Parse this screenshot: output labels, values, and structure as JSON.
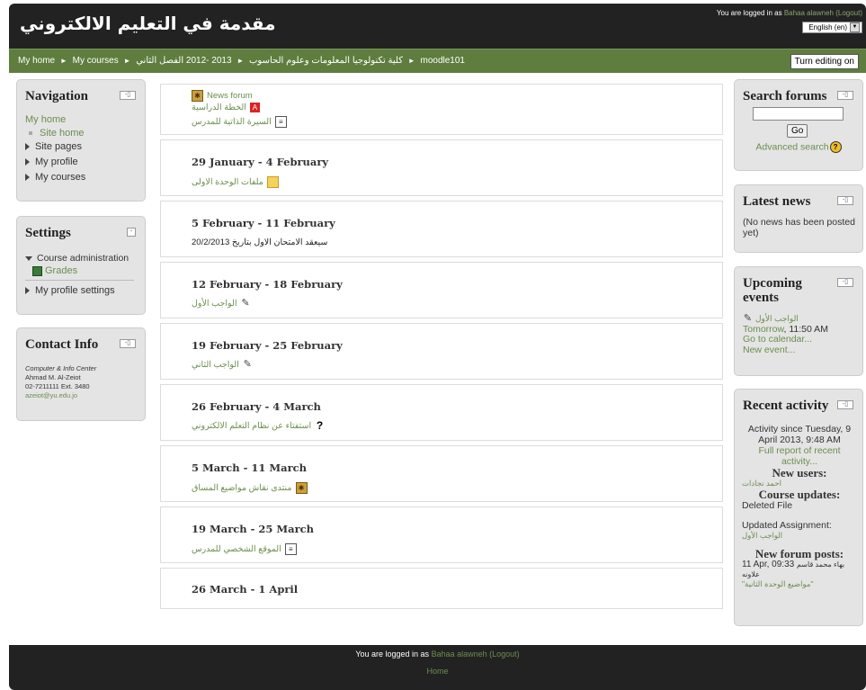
{
  "header": {
    "site_title": "مقدمة في التعليم الالكتروني",
    "logged_prefix": "You are logged in as",
    "user_name": "Bahaa alawneh",
    "logout_label": "(Logout)",
    "language": "English (en)"
  },
  "breadcrumb": {
    "items": [
      "My home",
      "My courses",
      "كلية تكنولوجيا المعلومات وعلوم الحاسوب",
      "2013 -2012 الفصل الثاني",
      "moodle101"
    ],
    "separator": "►"
  },
  "turn_editing_label": "Turn editing on",
  "navigation": {
    "title": "Navigation",
    "items": [
      {
        "label": "My home"
      },
      {
        "label": "Site home"
      },
      {
        "label": "Site pages"
      },
      {
        "label": "My profile"
      },
      {
        "label": "My courses"
      }
    ]
  },
  "settings": {
    "title": "Settings",
    "course_admin": "Course administration",
    "grades": "Grades",
    "profile_settings": "My profile settings"
  },
  "contact": {
    "title": "Contact Info",
    "org": "Computer & Info Center",
    "name": "Ahmad M. Al-Zeiot",
    "phone": "02-7211111 Ext. 3480",
    "email": "azeiot@yu.edu.jo"
  },
  "sections": [
    {
      "title": "",
      "activities": [
        {
          "icon": "forum-icon",
          "label": "News forum"
        },
        {
          "icon": "pdf-icon",
          "label": "الخطة الدراسية"
        },
        {
          "icon": "page-icon",
          "label": "السيرة الذاتية للمدرس"
        }
      ]
    },
    {
      "title": "29 January - 4 February",
      "activities": [
        {
          "icon": "folder-icon",
          "label": "ملفات الوحدة الاولى"
        }
      ]
    },
    {
      "title": "5 February - 11 February",
      "text": "سيعقد الامتحان الاول بتاريخ 20/2/2013"
    },
    {
      "title": "12 February - 18 February",
      "activities": [
        {
          "icon": "assignment-icon",
          "label": "الواجب الأول"
        }
      ]
    },
    {
      "title": "19 February - 25 February",
      "activities": [
        {
          "icon": "assignment-icon",
          "label": "الواجب الثاني"
        }
      ]
    },
    {
      "title": "26 February - 4 March",
      "activities": [
        {
          "icon": "question-icon",
          "label": "استفتاء عن نظام التعلم الالكتروني"
        }
      ]
    },
    {
      "title": "5 March - 11 March",
      "activities": [
        {
          "icon": "forum-icon",
          "label": "منتدى نقاش مواضيع المساق"
        }
      ]
    },
    {
      "title": "19 March - 25 March",
      "activities": [
        {
          "icon": "page-icon",
          "label": "الموقع الشخصي للمدرس"
        }
      ]
    },
    {
      "title": "26 March - 1 April"
    }
  ],
  "search_forums": {
    "title": "Search forums",
    "go_label": "Go",
    "advanced": "Advanced search"
  },
  "latest_news": {
    "title": "Latest news",
    "text": "(No news has been posted yet)"
  },
  "upcoming": {
    "title": "Upcoming events",
    "event": "الواجب الأول",
    "tomorrow": "Tomorrow",
    "time": ", 11:50 AM",
    "calendar": "Go to calendar...",
    "new_event": "New event..."
  },
  "recent": {
    "title": "Recent activity",
    "since": "Activity since Tuesday, 9 April 2013, 9:48 AM",
    "full_report": "Full report of recent activity...",
    "new_users_heading": "New users:",
    "new_user": "احمد نجادات",
    "course_updates_heading": "Course updates:",
    "deleted": "Deleted File",
    "updated_assignment": "Updated Assignment:",
    "assignment_name": "الواجب الأول",
    "forum_posts_heading": "New forum posts:",
    "post_date": "11 Apr, 09:33",
    "post_author": "بهاء محمد قاسم علاونه",
    "post_subject": "\"مواضيع الوحدة الثانية\""
  },
  "footer": {
    "logged_prefix": "You are logged in as",
    "user_name": "Bahaa alawneh",
    "logout_label": "(Logout)",
    "home_label": "Home"
  }
}
